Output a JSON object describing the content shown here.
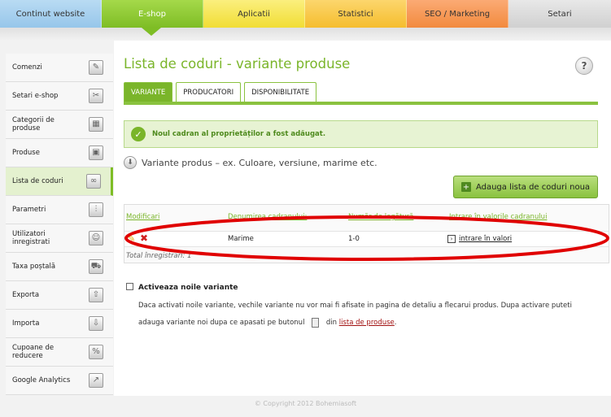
{
  "topnav": [
    {
      "label": "Continut website"
    },
    {
      "label": "E-shop"
    },
    {
      "label": "Aplicatii"
    },
    {
      "label": "Statistici"
    },
    {
      "label": "SEO / Marketing"
    },
    {
      "label": "Setari"
    }
  ],
  "sidebar": [
    {
      "label": "Comenzi",
      "icon": "clipboard-icon"
    },
    {
      "label": "Setari e-shop",
      "icon": "tools-icon"
    },
    {
      "label": "Categorii de produse",
      "icon": "boxes-icon"
    },
    {
      "label": "Produse",
      "icon": "product-icon"
    },
    {
      "label": "Lista de coduri",
      "icon": "binoculars-icon"
    },
    {
      "label": "Parametri",
      "icon": "sliders-icon"
    },
    {
      "label": "Utilizatori inregistrati",
      "icon": "users-icon"
    },
    {
      "label": "Taxa poștală",
      "icon": "truck-icon"
    },
    {
      "label": "Exporta",
      "icon": "export-icon"
    },
    {
      "label": "Importa",
      "icon": "import-icon"
    },
    {
      "label": "Cupoane de reducere",
      "icon": "coupon-icon"
    },
    {
      "label": "Google Analytics",
      "icon": "analytics-icon"
    }
  ],
  "main": {
    "title": "Lista de coduri - variante produse",
    "tabs": [
      {
        "label": "VARIANTE"
      },
      {
        "label": "PRODUCATORI"
      },
      {
        "label": "DISPONIBILITATE"
      }
    ],
    "success_message": "Noul cadran al proprietăților a fost adăugat.",
    "section_title": "Variante produs – ex. Culoare, versiune, marime etc.",
    "add_button": "Adauga lista de coduri noua",
    "table": {
      "headers": [
        "Modificari",
        "Denumirea cadranului:",
        "Număr de legătură",
        "Intrare în valorile cadranului"
      ],
      "rows": [
        {
          "name": "Marime",
          "link_number": "1-0",
          "action": "intrare în valori"
        }
      ],
      "total": "Total înregistrari: 1"
    },
    "activate": {
      "title": "Activeaza noile variante",
      "desc_1": "Daca activati noile variante, vechile variante nu vor mai fi afisate in pagina de detaliu a flecarui produs. Dupa activare puteti adauga variante noi dupa ce apasati pe butonul",
      "desc_2": "din",
      "link": "lista de produse",
      "desc_3": "."
    }
  },
  "footer": "© Copyright 2012 Bohemiasoft",
  "colors": {
    "accent": "#7ab52a",
    "highlight": "#e00000"
  }
}
